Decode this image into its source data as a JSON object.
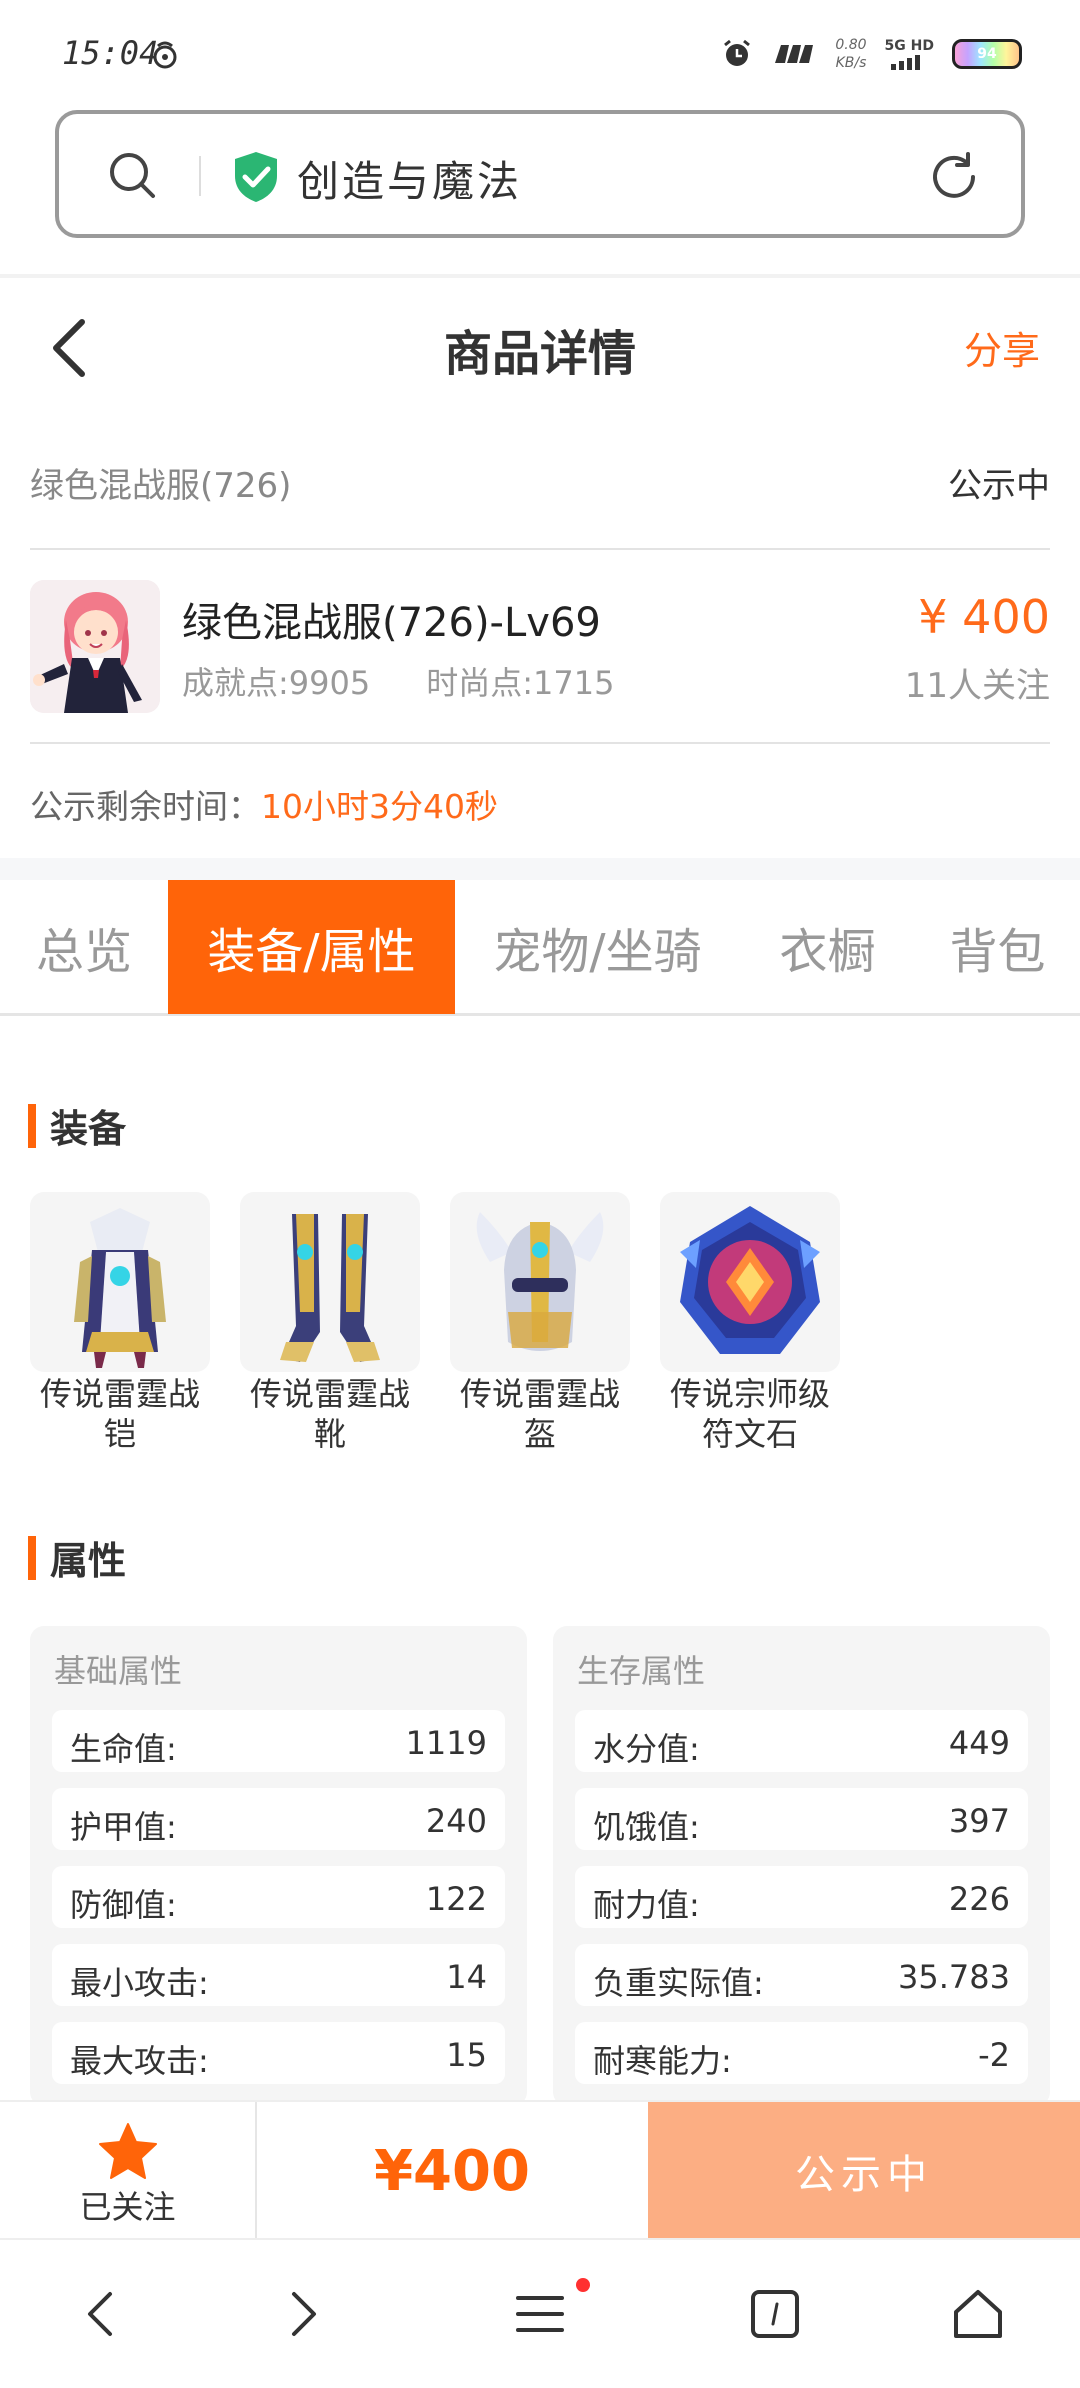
{
  "status_bar": {
    "time": "15:04",
    "net_speed_value": "0.80",
    "net_speed_unit": "KB/s",
    "network": "5G HD",
    "battery": "94"
  },
  "search": {
    "query": "创造与魔法"
  },
  "header": {
    "title": "商品详情",
    "share_label": "分享"
  },
  "goods": {
    "name": "绿色混战服(726)",
    "status": "公示中",
    "title": "绿色混战服(726)-Lv69",
    "achievement": "成就点:9905",
    "fashion": "时尚点:1715",
    "price": "¥ 400",
    "followers": "11人关注",
    "remain_label": "公示剩余时间：",
    "remain_value": "10小时3分40秒"
  },
  "tabs": [
    "总览",
    "装备/属性",
    "宠物/坐骑",
    "衣橱",
    "背包"
  ],
  "equipment": {
    "section_title": "装备",
    "items": [
      {
        "line1": "传说雷霆战",
        "line2": "铠"
      },
      {
        "line1": "传说雷霆战",
        "line2": "靴"
      },
      {
        "line1": "传说雷霆战",
        "line2": "盔"
      },
      {
        "line1": "传说宗师级",
        "line2": "符文石"
      }
    ]
  },
  "attributes": {
    "section_title": "属性",
    "basic": {
      "title": "基础属性",
      "rows": [
        {
          "k": "生命值:",
          "v": "1119"
        },
        {
          "k": "护甲值:",
          "v": "240"
        },
        {
          "k": "防御值:",
          "v": "122"
        },
        {
          "k": "最小攻击:",
          "v": "14"
        },
        {
          "k": "最大攻击:",
          "v": "15"
        }
      ]
    },
    "survival": {
      "title": "生存属性",
      "rows": [
        {
          "k": "水分值:",
          "v": "449"
        },
        {
          "k": "饥饿值:",
          "v": "397"
        },
        {
          "k": "耐力值:",
          "v": "226"
        },
        {
          "k": "负重实际值:",
          "v": "35.783"
        },
        {
          "k": "耐寒能力:",
          "v": "-2"
        }
      ]
    }
  },
  "action_bar": {
    "follow_label": "已关注",
    "price": "¥400",
    "status_button": "公示中"
  },
  "colors": {
    "accent": "#ff6409",
    "status_button_bg": "#fcae83",
    "shield": "#2bb673"
  }
}
